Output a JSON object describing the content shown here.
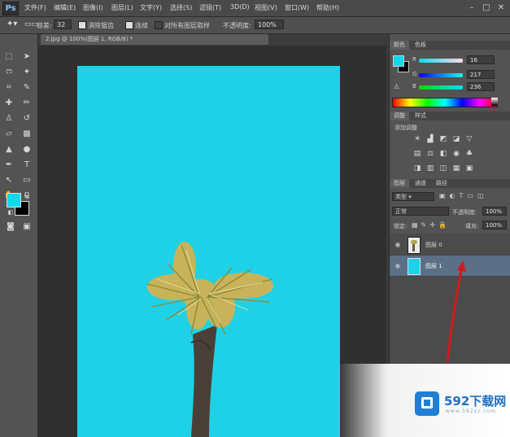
{
  "app": {
    "logo": "Ps"
  },
  "menu": [
    "文件(F)",
    "编辑(E)",
    "图像(I)",
    "图层(L)",
    "文字(Y)",
    "选择(S)",
    "滤镜(T)",
    "3D(D)",
    "视图(V)",
    "窗口(W)",
    "帮助(H)"
  ],
  "window_controls": [
    "–",
    "□",
    "✕"
  ],
  "options": {
    "tolerance_label": "容差:",
    "tolerance_value": "32",
    "antialias_label": "消除锯齿",
    "contiguous_label": "连续",
    "sample_all_label": "对所有图层取样",
    "opacity_label": "不透明度:",
    "opacity_value": "100%"
  },
  "document": {
    "tab_title": "2.jpg @ 100%(图层 1, RGB/8) *",
    "canvas_color": "#1fd1e6"
  },
  "color_panel": {
    "tabs": [
      "颜色",
      "色板"
    ],
    "r_label": "R",
    "r_value": "16",
    "g_label": "G",
    "g_value": "217",
    "b_label": "B",
    "b_value": "236",
    "foreground": "#10d9ec",
    "background": "#000000"
  },
  "adjustments_panel": {
    "tabs": [
      "调整",
      "样式"
    ],
    "title": "添加调整"
  },
  "layers_panel": {
    "tabs": [
      "图层",
      "通道",
      "路径"
    ],
    "kind_label": "类型",
    "blend_mode": "正常",
    "opacity_label": "不透明度:",
    "opacity_value": "100%",
    "lock_label": "锁定:",
    "fill_label": "填充:",
    "fill_value": "100%",
    "layers": [
      {
        "name": "图层 0",
        "selected": false
      },
      {
        "name": "图层 1",
        "selected": true
      }
    ]
  },
  "watermark": {
    "brand": "592下载网",
    "url": "www.592xz.com"
  }
}
